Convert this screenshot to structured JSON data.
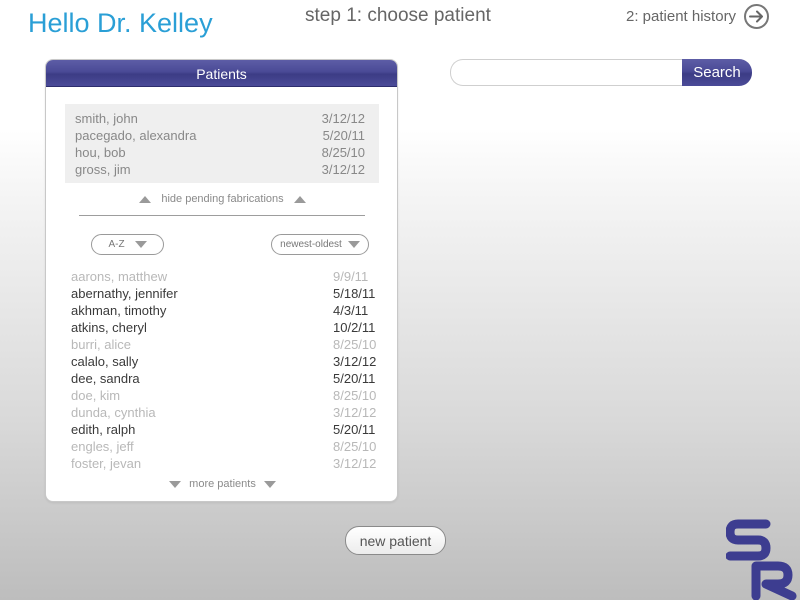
{
  "header": {
    "greeting": "Hello Dr. Kelley",
    "step": "step 1: choose patient",
    "next_step": "2: patient history"
  },
  "panel": {
    "title": "Patients",
    "pending": [
      {
        "name": "smith, john",
        "date": "3/12/12"
      },
      {
        "name": "pacegado, alexandra",
        "date": "5/20/11"
      },
      {
        "name": "hou, bob",
        "date": "8/25/10"
      },
      {
        "name": "gross, jim",
        "date": "3/12/12"
      }
    ],
    "hide_pending_label": "hide pending fabrications",
    "sort_alpha": "A-Z",
    "sort_date": "newest-oldest",
    "patients": [
      {
        "name": "aarons, matthew",
        "date": "9/9/11",
        "active": false
      },
      {
        "name": "abernathy, jennifer",
        "date": "5/18/11",
        "active": true
      },
      {
        "name": "akhman, timothy",
        "date": "4/3/11",
        "active": true
      },
      {
        "name": "atkins, cheryl",
        "date": "10/2/11",
        "active": true
      },
      {
        "name": "burri, alice",
        "date": "8/25/10",
        "active": false
      },
      {
        "name": "calalo, sally",
        "date": "3/12/12",
        "active": true
      },
      {
        "name": "dee, sandra",
        "date": "5/20/11",
        "active": true
      },
      {
        "name": "doe, kim",
        "date": "8/25/10",
        "active": false
      },
      {
        "name": "dunda, cynthia",
        "date": "3/12/12",
        "active": false
      },
      {
        "name": "edith, ralph",
        "date": "5/20/11",
        "active": true
      },
      {
        "name": "engles, jeff",
        "date": "8/25/10",
        "active": false
      },
      {
        "name": "foster, jevan",
        "date": "3/12/12",
        "active": false
      }
    ],
    "more_patients_label": "more patients"
  },
  "search": {
    "placeholder": "",
    "button_label": "Search"
  },
  "new_patient_label": "new patient",
  "logo": {
    "letters": "SR"
  },
  "colors": {
    "accent_blue": "#2a9fd6",
    "brand_purple": "#4a4a96",
    "active_text": "#3a3a3a",
    "inactive_text": "#b8b8b8"
  }
}
